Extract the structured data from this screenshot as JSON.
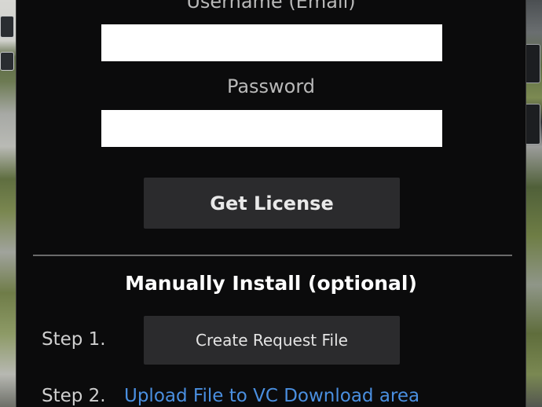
{
  "dialog": {
    "username_label": "Username (Email)",
    "username_value": "",
    "password_label": "Password",
    "password_value": "",
    "get_license_label": "Get License",
    "manual_install_title": "Manually Install (optional)",
    "step1_label": "Step 1.",
    "create_request_label": "Create Request File",
    "step2_label": "Step 2.",
    "upload_link_text": "Upload File to VC Download area"
  },
  "colors": {
    "panel_background": "#0b0b0c",
    "button_background": "#2b2b2d",
    "link": "#4a8fe0",
    "divider": "#6a6a6a"
  }
}
